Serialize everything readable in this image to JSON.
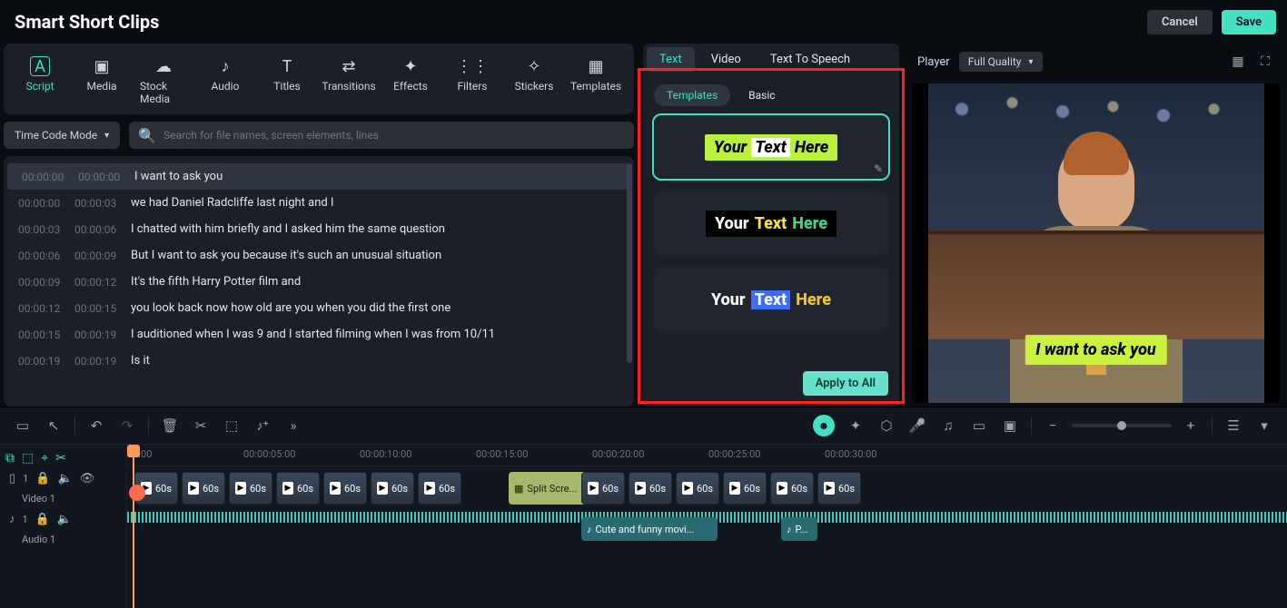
{
  "app_title": "Smart Short Clips",
  "topbar": {
    "cancel": "Cancel",
    "save": "Save"
  },
  "media_tabs": [
    {
      "id": "script",
      "label": "Script",
      "icon": "A"
    },
    {
      "id": "media",
      "label": "Media",
      "icon": "▣"
    },
    {
      "id": "stock",
      "label": "Stock Media",
      "icon": "☁"
    },
    {
      "id": "audio",
      "label": "Audio",
      "icon": "♪"
    },
    {
      "id": "titles",
      "label": "Titles",
      "icon": "T"
    },
    {
      "id": "transitions",
      "label": "Transitions",
      "icon": "⇄"
    },
    {
      "id": "effects",
      "label": "Effects",
      "icon": "✦"
    },
    {
      "id": "filters",
      "label": "Filters",
      "icon": "⋮⋮"
    },
    {
      "id": "stickers",
      "label": "Stickers",
      "icon": "✧"
    },
    {
      "id": "templates",
      "label": "Templates",
      "icon": "▦"
    }
  ],
  "mode": "Time Code Mode",
  "search_placeholder": "Search for file names, screen elements, lines",
  "script": [
    {
      "start": "00:00:00",
      "end": "00:00:00",
      "text": "I want to ask you",
      "selected": true
    },
    {
      "start": "00:00:00",
      "end": "00:00:03",
      "text": "we had Daniel Radcliffe last night and I"
    },
    {
      "start": "00:00:03",
      "end": "00:00:06",
      "text": "I chatted with him briefly and I asked him the same question"
    },
    {
      "start": "00:00:06",
      "end": "00:00:09",
      "text": "But I want to ask you because it's such an unusual situation"
    },
    {
      "start": "00:00:09",
      "end": "00:00:12",
      "text": "It's the fifth Harry Potter film and"
    },
    {
      "start": "00:00:12",
      "end": "00:00:15",
      "text": "you look back now how old are you when you did the first one"
    },
    {
      "start": "00:00:15",
      "end": "00:00:19",
      "text": "I auditioned when I was 9 and I started filming when I was from 10/11"
    },
    {
      "start": "00:00:19",
      "end": "00:00:19",
      "text": "Is it"
    }
  ],
  "mid_tabs": [
    {
      "id": "text",
      "label": "Text",
      "active": true
    },
    {
      "id": "video",
      "label": "Video"
    },
    {
      "id": "tts",
      "label": "Text To Speech"
    }
  ],
  "sub_tabs": [
    {
      "id": "templates",
      "label": "Templates",
      "active": true
    },
    {
      "id": "basic",
      "label": "Basic"
    }
  ],
  "tpl_words": {
    "w1": "Your",
    "w2": "Text",
    "w3": "Here"
  },
  "apply_all": "Apply to All",
  "player": {
    "label": "Player",
    "quality": "Full Quality",
    "caption": "I want to ask you"
  },
  "ruler": [
    "00:00",
    "00:00:05:00",
    "00:00:10:00",
    "00:00:15:00",
    "00:00:20:00",
    "00:00:25:00",
    "00:00:30:00"
  ],
  "tracks": {
    "video_label": "Video 1",
    "video_badge": "1",
    "audio_label": "Audio 1",
    "audio_badge": "1",
    "clip_label": "60s",
    "split_label": "Split Scre...",
    "audio_clip1": "Cute and funny movi...",
    "audio_clip2": "P..."
  }
}
